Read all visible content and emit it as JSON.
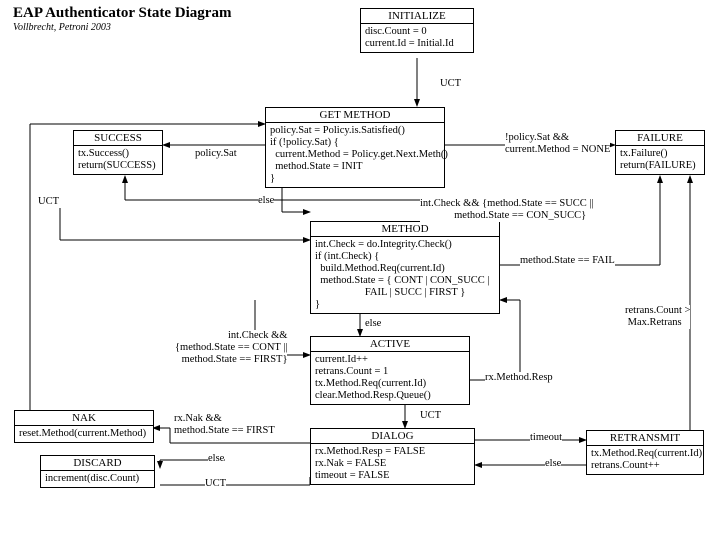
{
  "header": {
    "title": "EAP Authenticator State Diagram",
    "subtitle": "Vollbrecht, Petroni 2003"
  },
  "nodes": {
    "initialize": {
      "title": "INITIALIZE",
      "body": "disc.Count = 0\ncurrent.Id = Initial.Id"
    },
    "getmethod": {
      "title": "GET METHOD",
      "body": "policy.Sat = Policy.is.Satisfied()\nif (!policy.Sat) {\n  current.Method = Policy.get.Next.Meth()\n  method.State = INIT\n}"
    },
    "success": {
      "title": "SUCCESS",
      "body": "tx.Success()\nreturn(SUCCESS)"
    },
    "failure": {
      "title": "FAILURE",
      "body": "tx.Failure()\nreturn(FAILURE)"
    },
    "method": {
      "title": "METHOD",
      "body": "int.Check = do.Integrity.Check()\nif (int.Check) {\n  build.Method.Req(current.Id)\n  method.State = { CONT | CON_SUCC |\n                   FAIL | SUCC | FIRST }\n}"
    },
    "active": {
      "title": "ACTIVE",
      "body": "current.Id++\nretrans.Count = 1\ntx.Method.Req(current.Id)\nclear.Method.Resp.Queue()"
    },
    "dialog": {
      "title": "DIALOG",
      "body": "rx.Method.Resp = FALSE\nrx.Nak = FALSE\ntimeout = FALSE"
    },
    "retransmit": {
      "title": "RETRANSMIT",
      "body": "tx.Method.Req(current.Id)\nretrans.Count++"
    },
    "nak": {
      "title": "NAK",
      "body": "reset.Method(current.Method)"
    },
    "discard": {
      "title": "DISCARD",
      "body": "increment(disc.Count)"
    }
  },
  "labels": {
    "uct1": "UCT",
    "uct2": "UCT",
    "uct3": "UCT",
    "uct4": "UCT",
    "policySat": "policy.Sat",
    "notPolicySat": "!policy.Sat &&\ncurrent.Method = NONE",
    "else1": "else",
    "else2": "else",
    "else3": "else",
    "else4": "else",
    "succCond": "int.Check && {method.State == SUCC ||\n             method.State == CON_SUCC}",
    "failCond": "method.State == FAIL",
    "activeCond": "int.Check &&\n{method.State == CONT ||\nmethod.State == FIRST}",
    "rxResp": "rx.Method.Resp",
    "timeout": "timeout",
    "nakCond": "rx.Nak &&\nmethod.State == FIRST",
    "retransCond": "retrans.Count >\n Max.Retrans"
  }
}
